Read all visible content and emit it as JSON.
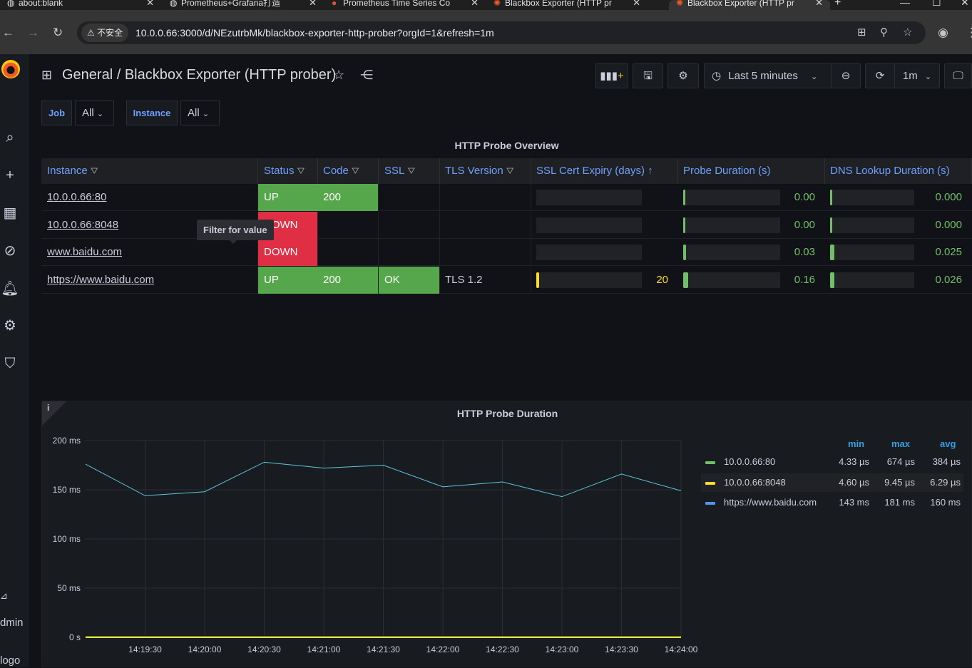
{
  "browser": {
    "tabs": [
      {
        "title": "about:blank",
        "active": false
      },
      {
        "title": "Prometheus+Grafana打造",
        "active": false
      },
      {
        "title": "Prometheus Time Series Co",
        "active": false
      },
      {
        "title": "Blackbox Exporter (HTTP pr",
        "active": false
      },
      {
        "title": "Blackbox Exporter (HTTP pr",
        "active": true
      }
    ],
    "security_label": "不安全",
    "url": "10.0.0.66:3000/d/NEzutrbMk/blackbox-exporter-http-prober?orgId=1&refresh=1m"
  },
  "sidebar": {
    "user_partial": "dmin",
    "logout_partial": "logo"
  },
  "header": {
    "folder": "General",
    "separator": "/",
    "dashboard": "Blackbox Exporter (HTTP prober)",
    "time_range": "Last 5 minutes",
    "refresh": "1m"
  },
  "variables": [
    {
      "label": "Job",
      "value": "All"
    },
    {
      "label": "Instance",
      "value": "All"
    }
  ],
  "table": {
    "title": "HTTP Probe Overview",
    "columns": [
      "Instance",
      "Status",
      "Code",
      "SSL",
      "TLS Version",
      "SSL Cert Expiry (days)",
      "Probe Duration (s)",
      "DNS Lookup Duration (s)"
    ],
    "sort_indicator": "↑",
    "rows": [
      {
        "instance": "10.0.0.66:80",
        "status": "UP",
        "code": "200",
        "ssl": "",
        "tls": "",
        "expiry": "",
        "expiry_level": 0,
        "probe": "0.00",
        "probe_level": 0.0,
        "dns": "0.000",
        "dns_level": 0.0
      },
      {
        "instance": "10.0.0.66:8048",
        "status": "DOWN",
        "code": "",
        "ssl": "",
        "tls": "",
        "expiry": "",
        "expiry_level": 0,
        "probe": "0.00",
        "probe_level": 0.0,
        "dns": "0.000",
        "dns_level": 0.0
      },
      {
        "instance": "www.baidu.com",
        "status": "DOWN",
        "code": "",
        "ssl": "",
        "tls": "",
        "expiry": "",
        "expiry_level": 0,
        "probe": "0.03",
        "probe_level": 0.03,
        "dns": "0.025",
        "dns_level": 0.05
      },
      {
        "instance": "https://www.baidu.com",
        "status": "UP",
        "code": "200",
        "ssl": "OK",
        "tls": "TLS 1.2",
        "expiry": "20",
        "expiry_level": 0.03,
        "probe": "0.16",
        "probe_level": 0.05,
        "dns": "0.026",
        "dns_level": 0.05
      }
    ],
    "tooltip": "Filter for value"
  },
  "graph": {
    "title": "HTTP Probe Duration",
    "legend_headers": [
      "min",
      "max",
      "avg"
    ],
    "legend": [
      {
        "name": "10.0.0.66:80",
        "color": "#73bf69",
        "min": "4.33 µs",
        "max": "674 µs",
        "avg": "384 µs"
      },
      {
        "name": "10.0.0.66:8048",
        "color": "#fade2a",
        "min": "4.60 µs",
        "max": "9.45 µs",
        "avg": "6.29 µs"
      },
      {
        "name": "https://www.baidu.com",
        "color": "#5794f2",
        "min": "143 ms",
        "max": "181 ms",
        "avg": "160 ms"
      }
    ]
  },
  "chart_data": {
    "type": "line",
    "title": "HTTP Probe Duration",
    "xlabel": "",
    "ylabel": "",
    "x": [
      "14:19:00",
      "14:19:30",
      "14:20:00",
      "14:20:30",
      "14:21:00",
      "14:21:30",
      "14:22:00",
      "14:22:30",
      "14:23:00",
      "14:23:30",
      "14:24:00"
    ],
    "x_ticks": [
      "14:19:30",
      "14:20:00",
      "14:20:30",
      "14:21:00",
      "14:21:30",
      "14:22:00",
      "14:22:30",
      "14:23:00",
      "14:23:30",
      "14:24:00"
    ],
    "y_ticks": [
      "0 s",
      "50 ms",
      "100 ms",
      "150 ms",
      "200 ms"
    ],
    "ylim": [
      0,
      200
    ],
    "y_unit": "ms",
    "grid": true,
    "legend_position": "right",
    "series": [
      {
        "name": "https://www.baidu.com",
        "color": "#5ac8de",
        "values": [
          176,
          144,
          148,
          178,
          172,
          175,
          153,
          158,
          143,
          166,
          149
        ]
      },
      {
        "name": "10.0.0.66:80",
        "color": "#73bf69",
        "values": [
          0.4,
          0.4,
          0.4,
          0.4,
          0.4,
          0.4,
          0.4,
          0.4,
          0.4,
          0.4,
          0.4
        ]
      },
      {
        "name": "10.0.0.66:8048",
        "color": "#fade2a",
        "values": [
          0.006,
          0.006,
          0.006,
          0.006,
          0.006,
          0.006,
          0.006,
          0.006,
          0.006,
          0.006,
          0.006
        ]
      }
    ]
  }
}
